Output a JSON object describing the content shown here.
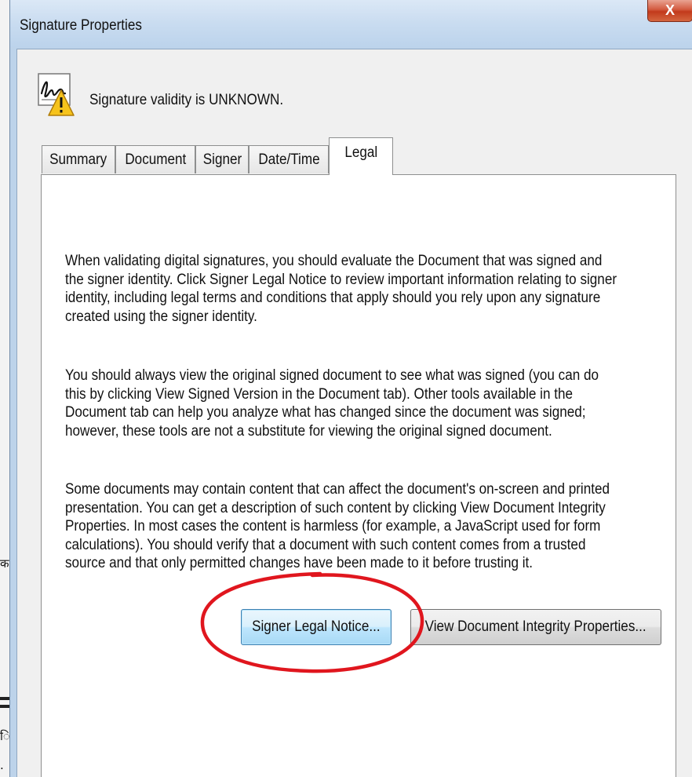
{
  "window": {
    "title": "Signature Properties",
    "close_label": "X"
  },
  "status": {
    "icon": "signature-warning-icon",
    "text": "Signature validity is UNKNOWN."
  },
  "tabs": [
    {
      "label": "Summary",
      "active": false
    },
    {
      "label": "Document",
      "active": false
    },
    {
      "label": "Signer",
      "active": false
    },
    {
      "label": "Date/Time",
      "active": false
    },
    {
      "label": "Legal",
      "active": true
    }
  ],
  "legal": {
    "paragraphs": [
      "When validating digital signatures, you should evaluate the Document that was signed and the signer identity. Click Signer Legal Notice to review important information relating to signer identity, including legal terms and conditions that apply should you rely upon any signature created using the signer identity.",
      "You should always view the original signed document to see what was signed (you can do this by clicking View Signed Version in the Document tab). Other tools available in the Document tab can help you analyze what has changed since the document was signed; however, these tools are not a substitute for viewing the original signed document.",
      "Some documents may contain content that can affect the document's on-screen and printed presentation. You can get a description of such content by clicking View Document Integrity Properties. In most cases the content is harmless (for example, a JavaScript used for form calculations). You should verify that a document with such content comes from a trusted source and that only permitted changes have been made to it before trusting it."
    ],
    "buttons": {
      "signer_legal_notice": "Signer Legal Notice...",
      "view_integrity": "View Document Integrity Properties..."
    }
  },
  "annotation": {
    "type": "red-ellipse-highlight",
    "color": "#e0161e"
  },
  "colors": {
    "titlebar": "#c9dcf0",
    "client_bg": "#f0f0f0",
    "panel_bg": "#ffffff",
    "default_button": "#bee6fd",
    "close_button": "#c23a1c"
  }
}
